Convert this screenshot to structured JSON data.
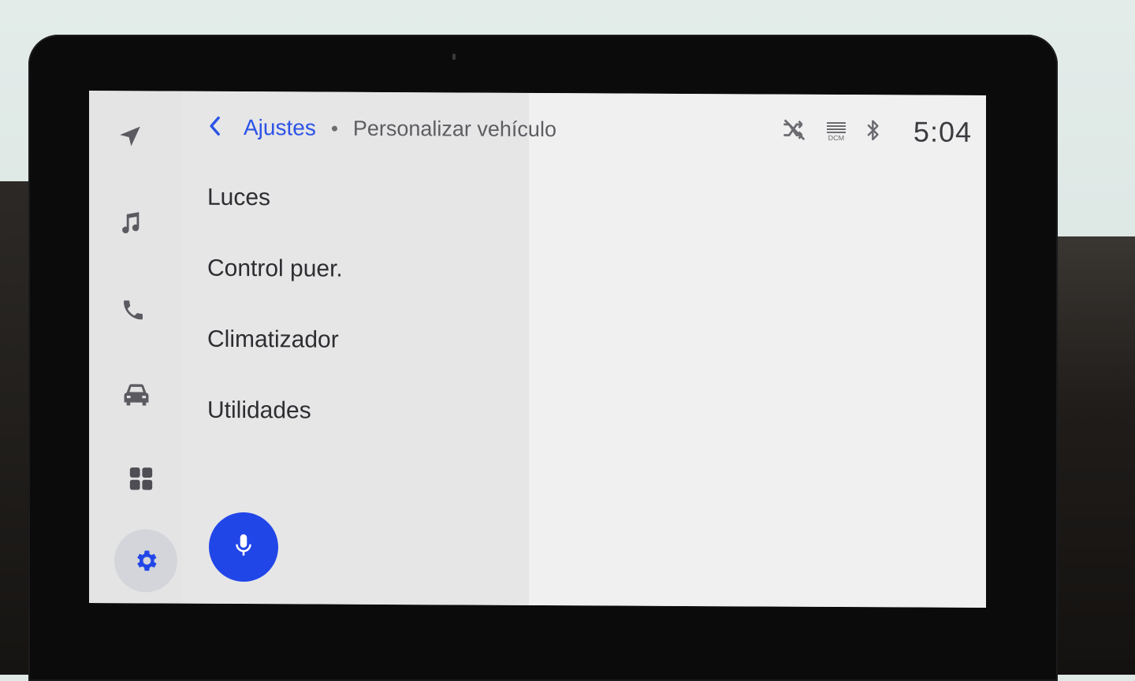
{
  "header": {
    "back_icon": "chevron-left-icon",
    "breadcrumb_main": "Ajustes",
    "breadcrumb_sub": "Personalizar vehículo"
  },
  "status_bar": {
    "time": "5:04",
    "dcm_label": "DCM",
    "icons": [
      "shuffle-off-icon",
      "dcm-signal-icon",
      "bluetooth-icon"
    ]
  },
  "rail": {
    "items": [
      {
        "icon": "navigation-arrow-icon"
      },
      {
        "icon": "music-note-icon"
      },
      {
        "icon": "phone-icon"
      },
      {
        "icon": "car-icon"
      },
      {
        "icon": "apps-grid-icon"
      },
      {
        "icon": "gear-icon",
        "selected": true
      }
    ]
  },
  "menu": {
    "items": [
      {
        "label": "Luces"
      },
      {
        "label": "Control puer."
      },
      {
        "label": "Climatizador"
      },
      {
        "label": "Utilidades"
      }
    ]
  },
  "voice_button": {
    "icon": "microphone-icon"
  },
  "colors": {
    "accent": "#2b53e6",
    "mic_button": "#2146e8",
    "rail_bg": "#e4e4e5",
    "list_bg": "#e6e6e7",
    "detail_bg": "#f0f0f0"
  }
}
